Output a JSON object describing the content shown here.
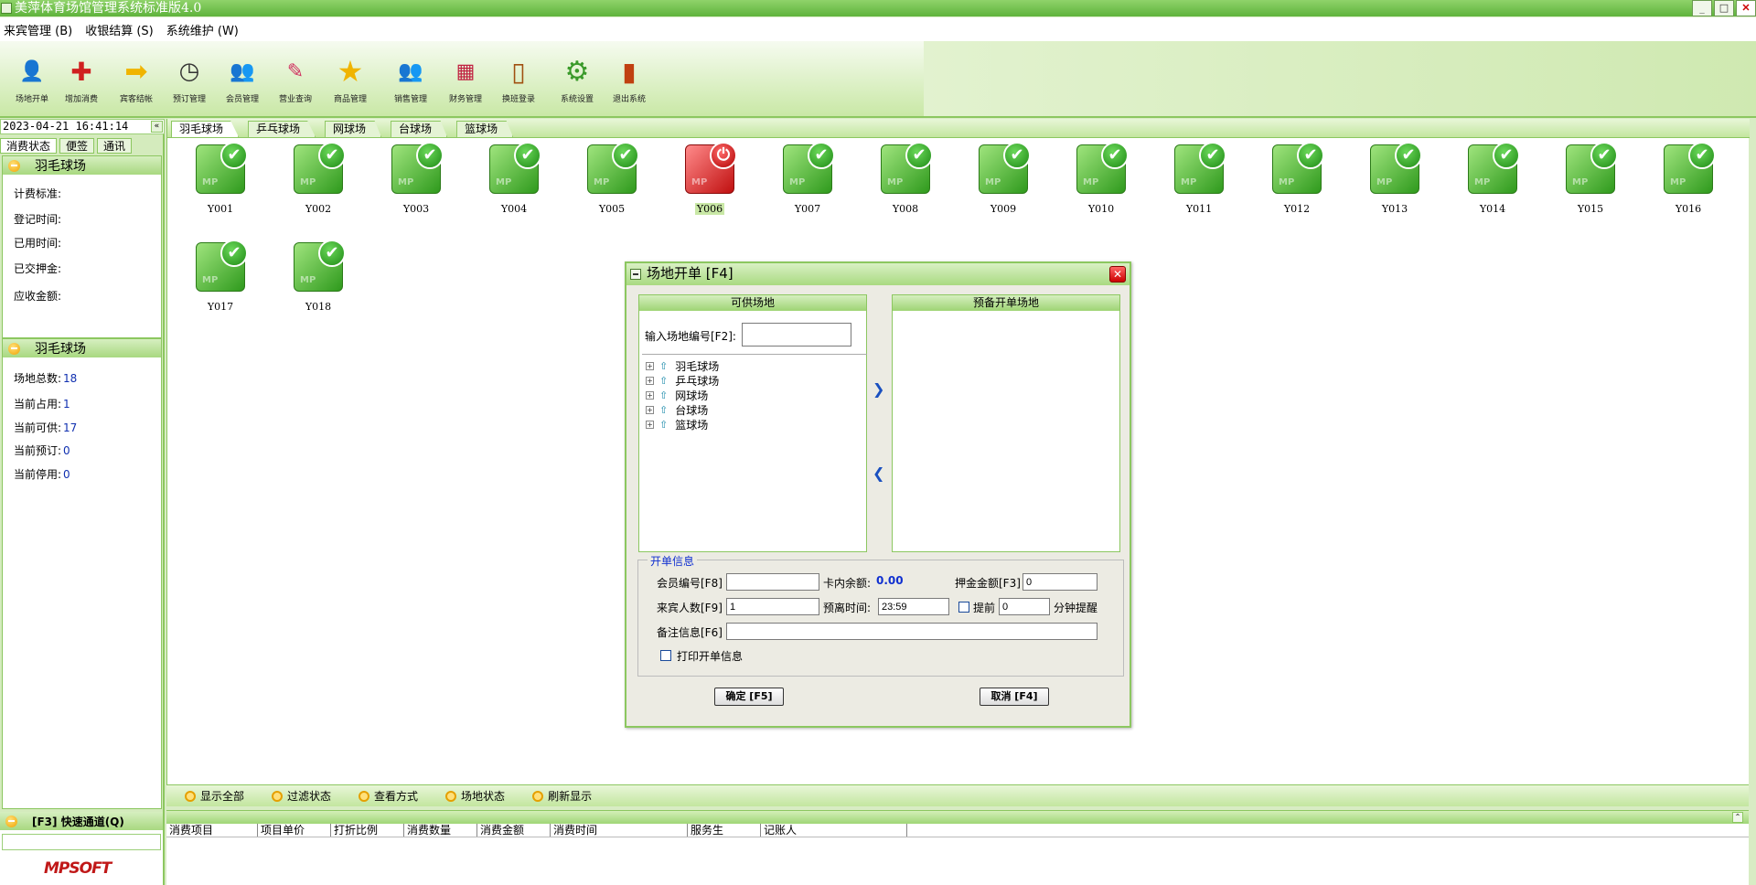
{
  "window": {
    "title": "美萍体育场馆管理系统标准版4.0"
  },
  "menu": [
    "来宾管理 (B)",
    "收银结算 (S)",
    "系统维护 (W)"
  ],
  "toolbar": [
    {
      "label": "场地开单",
      "icon": "person-open-icon"
    },
    {
      "label": "增加消费",
      "icon": "add-consume-icon"
    },
    {
      "label": "宾客结帐",
      "icon": "checkout-arrow-icon"
    },
    {
      "label": "预订管理",
      "icon": "reserve-clock-icon"
    },
    {
      "label": "会员管理",
      "icon": "members-icon"
    },
    {
      "label": "营业查询",
      "icon": "query-pencil-icon"
    },
    {
      "label": "商品管理",
      "icon": "goods-star-icon"
    },
    {
      "label": "销售管理",
      "icon": "sales-people-icon"
    },
    {
      "label": "财务管理",
      "icon": "finance-calc-icon"
    },
    {
      "label": "换班登录",
      "icon": "shift-door-icon"
    },
    {
      "label": "系统设置",
      "icon": "settings-gear-icon"
    },
    {
      "label": "退出系统",
      "icon": "exit-door-icon"
    }
  ],
  "left": {
    "datetime": "2023-04-21 16:41:14",
    "tabs": [
      "消费状态",
      "便签",
      "通讯"
    ],
    "section1": {
      "title": "羽毛球场",
      "rows": [
        {
          "label": "计费标准:"
        },
        {
          "label": "登记时间:"
        },
        {
          "label": "已用时间:"
        },
        {
          "label": "已交押金:"
        },
        {
          "label": "应收金额:"
        }
      ]
    },
    "section2": {
      "title": "羽毛球场",
      "stats": [
        {
          "label": "场地总数:",
          "value": "18"
        },
        {
          "label": "当前占用:",
          "value": "1"
        },
        {
          "label": "当前可供:",
          "value": "17"
        },
        {
          "label": "当前预订:",
          "value": "0"
        },
        {
          "label": "当前停用:",
          "value": "0"
        }
      ]
    },
    "quick": {
      "title": "[F3] 快速通道(Q)"
    },
    "logo": "MPSOFT"
  },
  "main": {
    "tabs": [
      "羽毛球场",
      "乒乓球场",
      "网球场",
      "台球场",
      "篮球场"
    ],
    "active_tab": "羽毛球场",
    "courts": [
      {
        "name": "Y001",
        "status": "free"
      },
      {
        "name": "Y002",
        "status": "free"
      },
      {
        "name": "Y003",
        "status": "free"
      },
      {
        "name": "Y004",
        "status": "free"
      },
      {
        "name": "Y005",
        "status": "free"
      },
      {
        "name": "Y006",
        "status": "used"
      },
      {
        "name": "Y007",
        "status": "free"
      },
      {
        "name": "Y008",
        "status": "free"
      },
      {
        "name": "Y009",
        "status": "free"
      },
      {
        "name": "Y010",
        "status": "free"
      },
      {
        "name": "Y011",
        "status": "free"
      },
      {
        "name": "Y012",
        "status": "free"
      },
      {
        "name": "Y013",
        "status": "free"
      },
      {
        "name": "Y014",
        "status": "free"
      },
      {
        "name": "Y015",
        "status": "free"
      },
      {
        "name": "Y016",
        "status": "free"
      },
      {
        "name": "Y017",
        "status": "free"
      },
      {
        "name": "Y018",
        "status": "free"
      }
    ],
    "bottom_buttons": [
      "显示全部",
      "过滤状态",
      "查看方式",
      "场地状态",
      "刷新显示"
    ],
    "grid_columns": [
      "消费项目",
      "项目单价",
      "打折比例",
      "消费数量",
      "消费金额",
      "消费时间",
      "服务生",
      "记账人"
    ]
  },
  "dialog": {
    "title": "场地开单 [F4]",
    "available_title": "可供场地",
    "pending_title": "预备开单场地",
    "input_label": "输入场地编号[F2]:",
    "input_value": "",
    "tree": [
      "羽毛球场",
      "乒乓球场",
      "网球场",
      "台球场",
      "篮球场"
    ],
    "info_legend": "开单信息",
    "member_label": "会员编号[F8]",
    "member_value": "",
    "balance_label": "卡内余额:",
    "balance_value": "0.00",
    "deposit_label": "押金金额[F3]",
    "deposit_value": "0",
    "guests_label": "来宾人数[F9]",
    "guests_value": "1",
    "leave_label": "预离时间:",
    "leave_value": "23:59",
    "remind_label": "提前",
    "remind_value": "0",
    "remind_suffix": "分钟提醒",
    "remark_label": "备注信息[F6]",
    "remark_value": "",
    "print_label": "打印开单信息",
    "ok_label": "确定 [F5]",
    "cancel_label": "取消 [F4]"
  },
  "colors": {
    "accent": "#8cc760",
    "free": "#2f9a1d",
    "used": "#c01010",
    "value_blue": "#1030b0"
  }
}
